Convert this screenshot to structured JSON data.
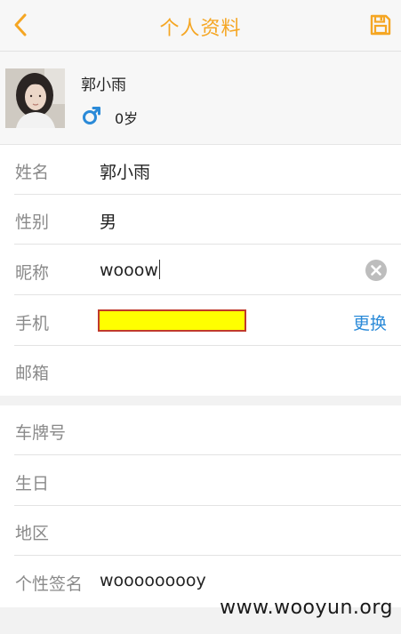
{
  "header": {
    "title": "个人资料",
    "back_icon": "chevron-left-icon",
    "save_icon": "save-icon",
    "accent_color": "#f5a623"
  },
  "profile": {
    "name": "郭小雨",
    "gender_icon": "male-icon",
    "age": "0岁"
  },
  "basic_info": {
    "rows": [
      {
        "label": "姓名",
        "value": "郭小雨"
      },
      {
        "label": "性别",
        "value": "男"
      },
      {
        "label": "昵称",
        "value": "wooow"
      },
      {
        "label": "手机",
        "value": "",
        "action": "更换"
      },
      {
        "label": "邮箱",
        "value": ""
      }
    ]
  },
  "extra_info": {
    "rows": [
      {
        "label": "车牌号",
        "value": ""
      },
      {
        "label": "生日",
        "value": ""
      },
      {
        "label": "地区",
        "value": ""
      },
      {
        "label": "个性签名",
        "value": "wooooooooy"
      }
    ]
  },
  "watermark": "www.wooyun.org",
  "colors": {
    "link": "#2a8ad8",
    "gender": "#2a8ad8",
    "redaction_fill": "#ffff00",
    "redaction_border": "#c0392b"
  }
}
